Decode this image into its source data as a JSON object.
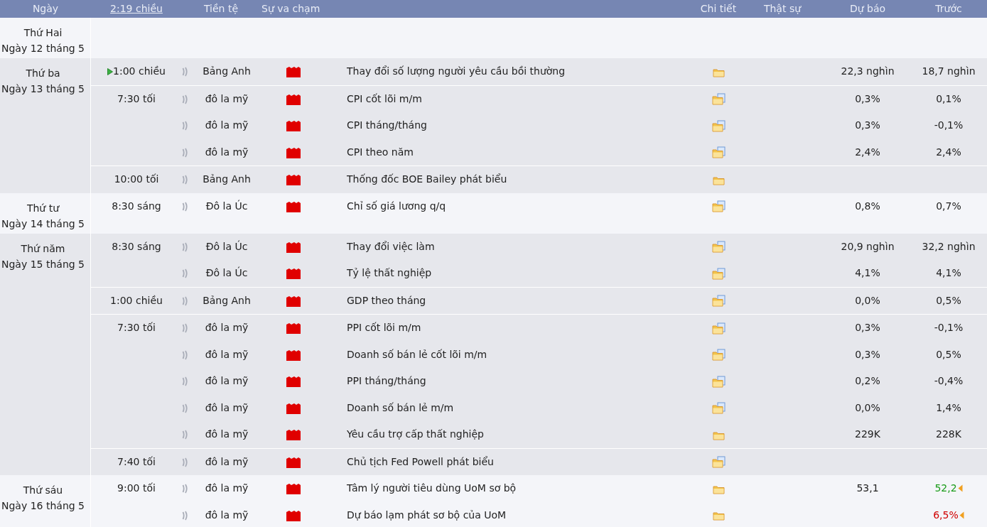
{
  "header": {
    "date": "Ngày",
    "time_link": "2:19 chiều",
    "currency": "Tiền tệ",
    "impact": "Sự va chạm",
    "detail": "Chi tiết",
    "actual": "Thật sự",
    "forecast": "Dự báo",
    "previous": "Trước"
  },
  "days": [
    {
      "day": "Thứ Hai",
      "date": "Ngày 12 tháng 5"
    },
    {
      "day": "Thứ ba",
      "date": "Ngày 13 tháng 5",
      "groups": [
        {
          "time": "1:00 chiều",
          "next": true,
          "events": [
            {
              "currency": "Bảng Anh",
              "title": "Thay đổi số lượng người yêu cầu bồi thường",
              "has_notes": false,
              "forecast": "22,3 nghìn",
              "previous": "18,7 nghìn"
            }
          ]
        },
        {
          "time": "7:30 tối",
          "next": false,
          "events": [
            {
              "currency": "đô la mỹ",
              "title": "CPI cốt lõi m/m",
              "has_notes": true,
              "forecast": "0,3%",
              "previous": "0,1%"
            },
            {
              "currency": "đô la mỹ",
              "title": "CPI tháng/tháng",
              "has_notes": true,
              "forecast": "0,3%",
              "previous": "-0,1%"
            },
            {
              "currency": "đô la mỹ",
              "title": "CPI theo năm",
              "has_notes": true,
              "forecast": "2,4%",
              "previous": "2,4%"
            }
          ]
        },
        {
          "time": "10:00 tối",
          "next": false,
          "events": [
            {
              "currency": "Bảng Anh",
              "title": "Thống đốc BOE Bailey phát biểu",
              "has_notes": false
            }
          ]
        }
      ]
    },
    {
      "day": "Thứ tư",
      "date": "Ngày 14 tháng 5",
      "groups": [
        {
          "time": "8:30 sáng",
          "next": false,
          "events": [
            {
              "currency": "Đô la Úc",
              "title": "Chỉ số giá lương q/q",
              "has_notes": true,
              "forecast": "0,8%",
              "previous": "0,7%"
            }
          ]
        }
      ]
    },
    {
      "day": "Thứ năm",
      "date": "Ngày 15 tháng 5",
      "groups": [
        {
          "time": "8:30 sáng",
          "next": false,
          "events": [
            {
              "currency": "Đô la Úc",
              "title": "Thay đổi việc làm",
              "has_notes": true,
              "forecast": "20,9 nghìn",
              "previous": "32,2 nghìn"
            },
            {
              "currency": "Đô la Úc",
              "title": "Tỷ lệ thất nghiệp",
              "has_notes": true,
              "forecast": "4,1%",
              "previous": "4,1%"
            }
          ]
        },
        {
          "time": "1:00 chiều",
          "next": false,
          "events": [
            {
              "currency": "Bảng Anh",
              "title": "GDP theo tháng",
              "has_notes": true,
              "forecast": "0,0%",
              "previous": "0,5%"
            }
          ]
        },
        {
          "time": "7:30 tối",
          "next": false,
          "events": [
            {
              "currency": "đô la mỹ",
              "title": "PPI cốt lõi m/m",
              "has_notes": true,
              "forecast": "0,3%",
              "previous": "-0,1%"
            },
            {
              "currency": "đô la mỹ",
              "title": "Doanh số bán lẻ cốt lõi m/m",
              "has_notes": true,
              "forecast": "0,3%",
              "previous": "0,5%"
            },
            {
              "currency": "đô la mỹ",
              "title": "PPI tháng/tháng",
              "has_notes": true,
              "forecast": "0,2%",
              "previous": "-0,4%"
            },
            {
              "currency": "đô la mỹ",
              "title": "Doanh số bán lẻ m/m",
              "has_notes": true,
              "forecast": "0,0%",
              "previous": "1,4%"
            },
            {
              "currency": "đô la mỹ",
              "title": "Yêu cầu trợ cấp thất nghiệp",
              "has_notes": false,
              "forecast": "229K",
              "previous": "228K"
            }
          ]
        },
        {
          "time": "7:40 tối",
          "next": false,
          "events": [
            {
              "currency": "đô la mỹ",
              "title": "Chủ tịch Fed Powell phát biểu",
              "has_notes": true
            }
          ]
        }
      ]
    },
    {
      "day": "Thứ sáu",
      "date": "Ngày 16 tháng 5",
      "groups": [
        {
          "time": "9:00 tối",
          "next": false,
          "events": [
            {
              "currency": "đô la mỹ",
              "title": "Tâm lý người tiêu dùng UoM sơ bộ",
              "has_notes": false,
              "forecast": "53,1",
              "previous": "52,2",
              "color": "#1a9c1a"
            },
            {
              "currency": "đô la mỹ",
              "title": "Dự báo lạm phát sơ bộ của UoM",
              "has_notes": false,
              "previous": "6,5%",
              "color": "#d00000"
            }
          ]
        }
      ]
    }
  ]
}
